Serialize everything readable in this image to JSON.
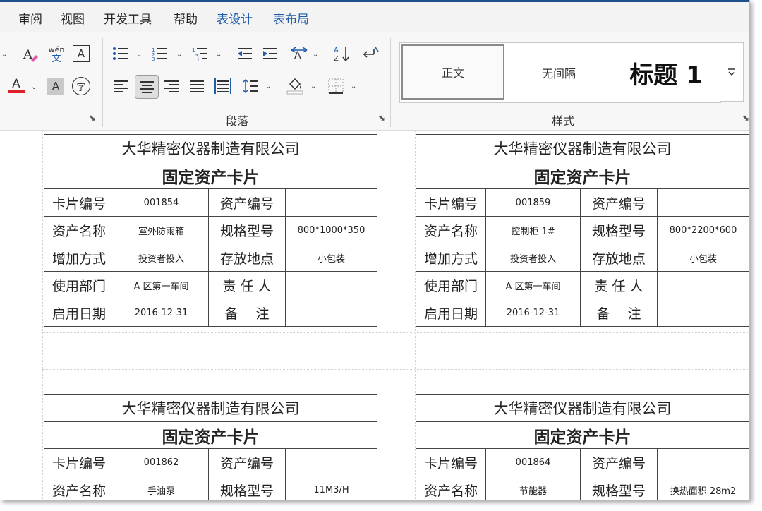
{
  "menu": [
    "审阅",
    "视图",
    "开发工具",
    "帮助",
    "表设计",
    "表布局"
  ],
  "menu_active": [
    "表设计",
    "表布局"
  ],
  "ribbon": {
    "paragraph_group_label": "段落",
    "styles_group_label": "样式",
    "font_buttons": {
      "pinyin_top": "wén",
      "pinyin_bottom": "文",
      "border_char": "A",
      "font_color_char": "A",
      "shading_char": "A",
      "enclose_char": "字",
      "font_color": "#e0202a"
    },
    "styles": [
      "正文",
      "无间隔",
      "标题 1"
    ]
  },
  "card_header": {
    "company": "大华精密仪器制造有限公司",
    "title": "固定资产卡片"
  },
  "labels": {
    "card_no": "卡片编号",
    "asset_no": "资产编号",
    "asset_name": "资产名称",
    "spec": "规格型号",
    "add_method": "增加方式",
    "location": "存放地点",
    "department": "使用部门",
    "owner": "责 任 人",
    "start_date": "启用日期",
    "remark": "备　 注"
  },
  "cards": [
    {
      "card_no": "001854",
      "asset_no": "",
      "asset_name": "室外防雨箱",
      "spec": "800*1000*350",
      "add_method": "投资者投入",
      "location": "小包装",
      "department": "A 区第一车间",
      "owner": "",
      "start_date": "2016-12-31",
      "remark": ""
    },
    {
      "card_no": "001859",
      "asset_no": "",
      "asset_name": "控制柜 1#",
      "spec": "800*2200*600",
      "add_method": "投资者投入",
      "location": "小包装",
      "department": "A 区第一车间",
      "owner": "",
      "start_date": "2016-12-31",
      "remark": ""
    },
    {
      "card_no": "001862",
      "asset_no": "",
      "asset_name": "手油泵",
      "spec": "11M3/H",
      "add_method": "",
      "location": "",
      "department": "",
      "owner": "",
      "start_date": "",
      "remark": ""
    },
    {
      "card_no": "001864",
      "asset_no": "",
      "asset_name": "节能器",
      "spec": "换热面积 28m2",
      "add_method": "",
      "location": "",
      "department": "",
      "owner": "",
      "start_date": "",
      "remark": ""
    }
  ]
}
